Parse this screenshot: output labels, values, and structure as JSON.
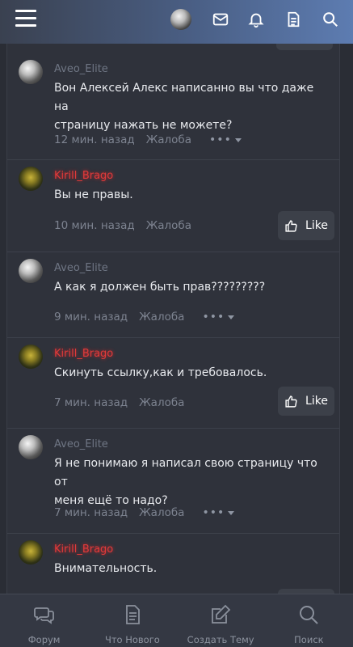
{
  "header": {
    "icons": [
      "menu-icon",
      "avatar",
      "mail-icon",
      "bell-icon",
      "document-icon",
      "search-icon"
    ]
  },
  "posts": [
    {
      "author": "Aveo_Elite",
      "role": "aveo",
      "message_lines": [
        "Вон Алексей Алекс написанно вы что даже на",
        "страницу нажать не можете?"
      ],
      "time": "12 мин. назад",
      "report": "Жалоба",
      "more": "•••",
      "like": ""
    },
    {
      "author": "Kirill_Brago",
      "role": "kirill",
      "message_lines": [
        "Вы не правы."
      ],
      "time": "10 мин. назад",
      "report": "Жалоба",
      "more": "",
      "like": "Like"
    },
    {
      "author": "Aveo_Elite",
      "role": "aveo",
      "message_lines": [
        "А как я должен быть прав?????????"
      ],
      "time": "9 мин. назад",
      "report": "Жалоба",
      "more": "•••",
      "like": ""
    },
    {
      "author": "Kirill_Brago",
      "role": "kirill",
      "message_lines": [
        "Скинуть ссылку,как и требовалось."
      ],
      "time": "7 мин. назад",
      "report": "Жалоба",
      "more": "",
      "like": "Like"
    },
    {
      "author": "Aveo_Elite",
      "role": "aveo",
      "message_lines": [
        "Я не понимаю я написал свою страницу что от",
        "меня ещё то надо?"
      ],
      "time": "7 мин. назад",
      "report": "Жалоба",
      "more": "•••",
      "like": ""
    },
    {
      "author": "Kirill_Brago",
      "role": "kirill",
      "message_lines": [
        "Внимательность."
      ],
      "time": "",
      "report": "",
      "more": "",
      "like": ""
    }
  ],
  "bottom_nav": [
    {
      "label": "Форум",
      "icon": "chat-bubbles-icon"
    },
    {
      "label": "Что Нового",
      "icon": "document-icon"
    },
    {
      "label": "Создать Тему",
      "icon": "edit-icon"
    },
    {
      "label": "Поиск",
      "icon": "search-icon"
    }
  ],
  "colors": {
    "background": "#2a2d35",
    "header_gradient_start": "#3a4150",
    "header_gradient_end": "#5d7cb1",
    "username_aveo": "#6f7684",
    "username_kirill": "#e03a3a"
  }
}
